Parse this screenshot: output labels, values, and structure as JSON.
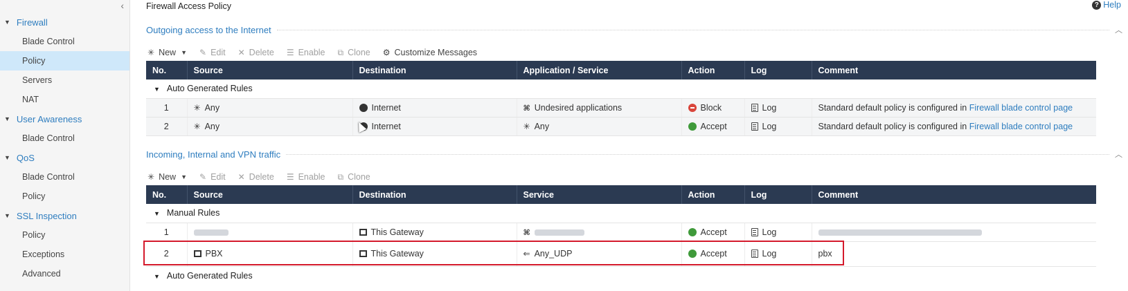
{
  "sidebar": {
    "collapse": "‹",
    "groups": [
      {
        "label": "Firewall",
        "items": [
          "Blade Control",
          "Policy",
          "Servers",
          "NAT"
        ]
      },
      {
        "label": "User Awareness",
        "items": [
          "Blade Control"
        ]
      },
      {
        "label": "QoS",
        "items": [
          "Blade Control",
          "Policy"
        ]
      },
      {
        "label": "SSL Inspection",
        "items": [
          "Policy",
          "Exceptions",
          "Advanced"
        ]
      }
    ],
    "active": "Firewall / Policy"
  },
  "header": {
    "title": "Firewall Access Policy",
    "help": "Help"
  },
  "outgoing": {
    "title": "Outgoing access to the Internet",
    "toolbar": {
      "new": "New",
      "edit": "Edit",
      "delete": "Delete",
      "enable": "Enable",
      "clone": "Clone",
      "customize": "Customize Messages"
    },
    "columns": [
      "No.",
      "Source",
      "Destination",
      "Application / Service",
      "Action",
      "Log",
      "Comment"
    ],
    "group": "Auto Generated Rules",
    "rows": [
      {
        "no": "1",
        "source": "Any",
        "destination": "Internet",
        "service": "Undesired applications",
        "action": "Block",
        "log": "Log",
        "comment_prefix": "Standard default policy is configured in ",
        "comment_link": "Firewall blade control page"
      },
      {
        "no": "2",
        "source": "Any",
        "destination": "Internet",
        "service": "Any",
        "action": "Accept",
        "log": "Log",
        "comment_prefix": "Standard default policy is configured in ",
        "comment_link": "Firewall blade control page"
      }
    ]
  },
  "incoming": {
    "title": "Incoming, Internal and VPN traffic",
    "toolbar": {
      "new": "New",
      "edit": "Edit",
      "delete": "Delete",
      "enable": "Enable",
      "clone": "Clone"
    },
    "columns": [
      "No.",
      "Source",
      "Destination",
      "Service",
      "Action",
      "Log",
      "Comment"
    ],
    "group_manual": "Manual Rules",
    "group_auto": "Auto Generated Rules",
    "rows": [
      {
        "no": "1",
        "source": "",
        "destination": "This Gateway",
        "service": "",
        "action": "Accept",
        "log": "Log",
        "comment": ""
      },
      {
        "no": "2",
        "source": "PBX",
        "destination": "This Gateway",
        "service": "Any_UDP",
        "action": "Accept",
        "log": "Log",
        "comment": "pbx"
      }
    ]
  },
  "colors": {
    "header": "#2b3a52",
    "link": "#2e7dbf",
    "highlight": "#d4192b",
    "block": "#d9453b",
    "accept": "#3f9a3a"
  }
}
